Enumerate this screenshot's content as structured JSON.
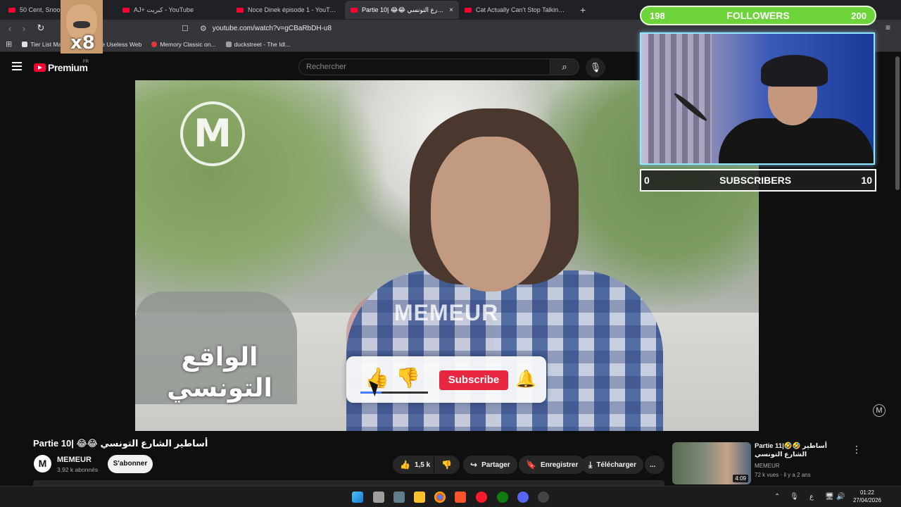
{
  "browser": {
    "tabs": [
      {
        "title": "50 Cent, Snoop E",
        "active": false
      },
      {
        "title": "AJ+ كبريت - YouTube",
        "active": false
      },
      {
        "title": "Noce Dinek épisode 1 - YouTube",
        "active": false
      },
      {
        "title": "Partie 10| 😂😂 أساطير الشارع التونسي",
        "active": true
      },
      {
        "title": "Cat Actually Can't Stop Talking To Hi",
        "active": false
      }
    ],
    "new_tab": "+",
    "close_tab": "×",
    "url": "youtube.com/watch?v=gCBaRbDH-u8",
    "bookmarks": [
      {
        "label": "Tier List Make",
        "color": "#e0e0e0"
      },
      {
        "label": "The Useless Web",
        "color": "#e91e63"
      },
      {
        "label": "Memory Classic on...",
        "color": "#e53935"
      },
      {
        "label": "duckstreet - The Idl...",
        "color": "#9e9e9e"
      }
    ]
  },
  "youtube": {
    "logo_text": "Premium",
    "logo_region": "FR",
    "search_placeholder": "Rechercher"
  },
  "video_overlay": {
    "watermark_text": "MEMEUR",
    "channel_logo_letter": "M",
    "arabic_caption": "الواقع التونسي",
    "subscribe_label": "Subscribe"
  },
  "stream_overlay": {
    "followers_label": "FOLLOWERS",
    "followers_current": "198",
    "followers_goal": "200",
    "subscribers_label": "SUBSCRIBERS",
    "subscribers_current": "0",
    "subscribers_goal": "10",
    "emote_text": "x8"
  },
  "video_info": {
    "title": "Partie 10| 😂😂 أساطير الشارع التونسي",
    "channel_name": "MEMEUR",
    "channel_initial": "M",
    "subscribers": "3,92 k abonnés",
    "subscribe_button": "S'abonner",
    "likes": "1,5 k",
    "share": "Partager",
    "save": "Enregistrer",
    "download": "Télécharger",
    "more": "..."
  },
  "recommended": [
    {
      "title": "Partie 11|🤣🤣 أساطير الشارع التونسي",
      "channel": "MEMEUR",
      "meta": "72 k vues · il y a 2 ans",
      "duration": "4:09"
    }
  ],
  "taskbar": {
    "time": "01:22",
    "date": "27/04/2026",
    "language": "ع"
  }
}
